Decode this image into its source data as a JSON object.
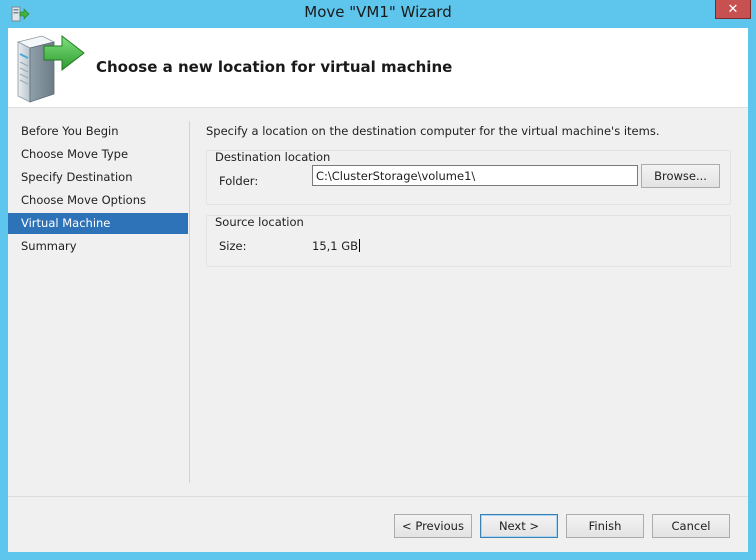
{
  "window": {
    "title": "Move \"VM1\" Wizard",
    "close_label": "✕"
  },
  "header": {
    "title": "Choose a new location for virtual machine"
  },
  "nav": {
    "items": [
      {
        "label": "Before You Begin",
        "selected": false
      },
      {
        "label": "Choose Move Type",
        "selected": false
      },
      {
        "label": "Specify Destination",
        "selected": false
      },
      {
        "label": "Choose Move Options",
        "selected": false
      },
      {
        "label": "Virtual Machine",
        "selected": true
      },
      {
        "label": "Summary",
        "selected": false
      }
    ]
  },
  "content": {
    "intro": "Specify a location on the destination computer for the virtual machine's items.",
    "destination": {
      "group_title": "Destination location",
      "folder_label": "Folder:",
      "folder_value": "C:\\ClusterStorage\\volume1\\",
      "browse_label": "Browse..."
    },
    "source": {
      "group_title": "Source location",
      "size_label": "Size:",
      "size_value": "15,1 GB"
    }
  },
  "footer": {
    "previous_label": "< Previous",
    "next_label": "Next >",
    "finish_label": "Finish",
    "cancel_label": "Cancel"
  },
  "colors": {
    "titlebar": "#5ec6ec",
    "selection": "#2e73b8",
    "close": "#c75050"
  },
  "icons": [
    "wizard-app-icon",
    "close-icon",
    "server-move-icon"
  ]
}
